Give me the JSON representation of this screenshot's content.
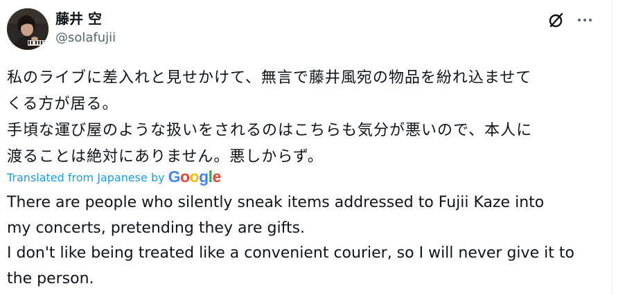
{
  "author": {
    "display_name": "藤井 空",
    "handle": "@solafujii"
  },
  "header": {
    "grok_icon": "grok-slash-circle-icon",
    "more_icon": "more-ellipsis-icon"
  },
  "tweet": {
    "text": "私のライブに差入れと見せかけて、無言で藤井風宛の物品を紛れ込ませて\nくる方が居る。\n手頃な運び屋のような扱いをされるのはこちらも気分が悪いので、本人に\n渡ることは絶対にありません。悪しからず。",
    "translated_label": "Translated from Japanese by",
    "google_logo": "Google",
    "translation": "There are people who silently sneak items addressed to Fujii Kaze into\nmy concerts, pretending they are gifts.\nI don't like being treated like a convenient courier, so I will never give it to\nthe person."
  },
  "colors": {
    "text_primary": "#0f1419",
    "text_secondary": "#536471",
    "link_blue": "#1d9bf0",
    "border": "#eff3f4"
  }
}
